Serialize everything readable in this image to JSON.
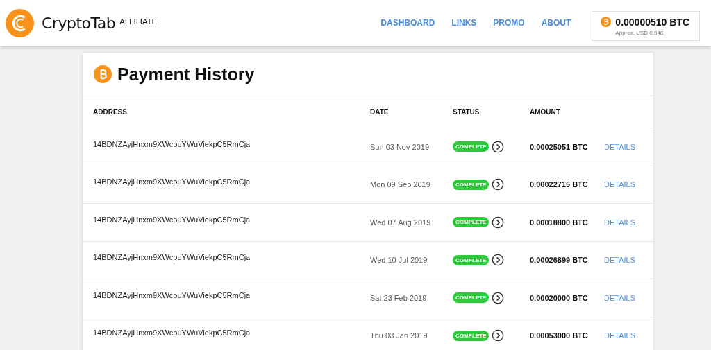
{
  "header": {
    "brand": "CryptoTab",
    "brand_sub": "AFFILIATE",
    "nav": [
      {
        "label": "DASHBOARD"
      },
      {
        "label": "LINKS"
      },
      {
        "label": "PROMO"
      },
      {
        "label": "ABOUT"
      }
    ],
    "balance": {
      "amount": "0.00000510 BTC",
      "approx": "Approx. USD 0.048"
    }
  },
  "page": {
    "title": "Payment History"
  },
  "table": {
    "columns": [
      "ADDRESS",
      "DATE",
      "STATUS",
      "AMOUNT"
    ],
    "rows": [
      {
        "address": "14BDNZAyjHnxm9XWcpuYWuViekpC5RmCja",
        "date": "Sun 03 Nov 2019",
        "status": "COMPLETE",
        "kind": "complete",
        "amount": "0.00025051 BTC",
        "link": "DETAILS"
      },
      {
        "address": "14BDNZAyjHnxm9XWcpuYWuViekpC5RmCja",
        "date": "Mon 09 Sep 2019",
        "status": "COMPLETE",
        "kind": "complete",
        "amount": "0.00022715 BTC",
        "link": "DETAILS"
      },
      {
        "address": "14BDNZAyjHnxm9XWcpuYWuViekpC5RmCja",
        "date": "Wed 07 Aug 2019",
        "status": "COMPLETE",
        "kind": "complete",
        "amount": "0.00018800 BTC",
        "link": "DETAILS"
      },
      {
        "address": "14BDNZAyjHnxm9XWcpuYWuViekpC5RmCja",
        "date": "Wed 10 Jul 2019",
        "status": "COMPLETE",
        "kind": "complete",
        "amount": "0.00026899 BTC",
        "link": "DETAILS"
      },
      {
        "address": "14BDNZAyjHnxm9XWcpuYWuViekpC5RmCja",
        "date": "Sat 23 Feb 2019",
        "status": "COMPLETE",
        "kind": "complete",
        "amount": "0.00020000 BTC",
        "link": "DETAILS"
      },
      {
        "address": "14BDNZAyjHnxm9XWcpuYWuViekpC5RmCja",
        "date": "Thu 03 Jan 2019",
        "status": "COMPLETE",
        "kind": "complete",
        "amount": "0.00053000 BTC",
        "link": "DETAILS"
      }
    ]
  }
}
